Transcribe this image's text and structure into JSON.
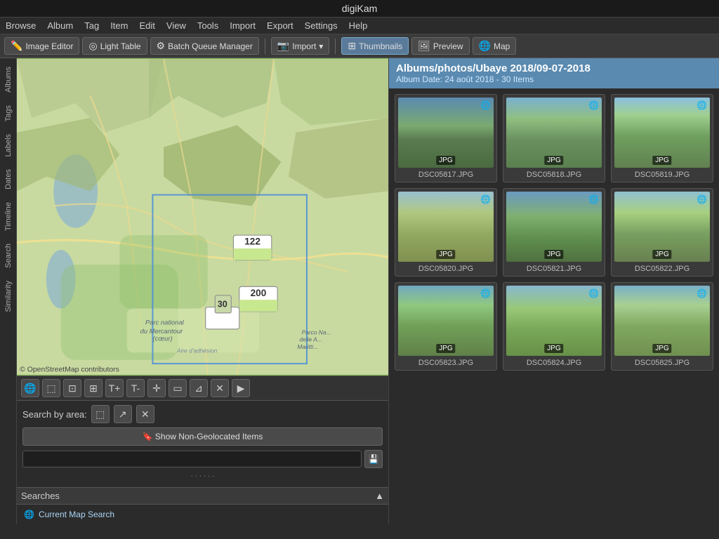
{
  "title_bar": {
    "app_name": "digiKam"
  },
  "menu_bar": {
    "items": [
      "Browse",
      "Album",
      "Tag",
      "Item",
      "Edit",
      "View",
      "Tools",
      "Import",
      "Export",
      "Settings",
      "Help"
    ]
  },
  "toolbar": {
    "buttons": [
      {
        "id": "image-editor",
        "icon": "✏️",
        "label": "Image Editor",
        "active": false
      },
      {
        "id": "light-table",
        "icon": "◎",
        "label": "Light Table",
        "active": false
      },
      {
        "id": "batch-queue",
        "icon": "⚙",
        "label": "Batch Queue Manager",
        "active": false
      },
      {
        "id": "import",
        "icon": "📷",
        "label": "Import",
        "active": false,
        "has_arrow": true
      },
      {
        "id": "thumbnails",
        "icon": "⊞",
        "label": "Thumbnails",
        "active": true
      },
      {
        "id": "preview",
        "icon": "🖼",
        "label": "Preview",
        "active": false
      },
      {
        "id": "map",
        "icon": "🌐",
        "label": "Map",
        "active": false
      }
    ]
  },
  "sidebar": {
    "tabs": [
      "Albums",
      "Tags",
      "Labels",
      "Dates",
      "Timeline",
      "Search",
      "Similarity"
    ]
  },
  "map": {
    "attribution": "© OpenStreetMap contributors",
    "cluster_122": "122",
    "cluster_200": "200",
    "cluster_30": "30"
  },
  "map_toolbar": {
    "buttons": [
      {
        "id": "globe",
        "icon": "🌐"
      },
      {
        "id": "select-area",
        "icon": "⬚"
      },
      {
        "id": "filter-area",
        "icon": "⊡"
      },
      {
        "id": "image-view",
        "icon": "⊞"
      },
      {
        "id": "text",
        "icon": "T+"
      },
      {
        "id": "text-minus",
        "icon": "T-"
      },
      {
        "id": "move",
        "icon": "✛"
      },
      {
        "id": "frame",
        "icon": "▭"
      },
      {
        "id": "filter",
        "icon": "⊿"
      },
      {
        "id": "clear",
        "icon": "✕"
      },
      {
        "id": "play",
        "icon": "▶"
      }
    ]
  },
  "search_area": {
    "label": "Search by area:",
    "area_btns": [
      {
        "id": "area-select",
        "icon": "⬚"
      },
      {
        "id": "area-add",
        "icon": "↗"
      },
      {
        "id": "area-clear",
        "icon": "✕"
      }
    ],
    "show_non_geo_btn": "🔖 Show Non-Geolocated Items",
    "search_placeholder": "",
    "save_icon": "💾",
    "searches_label": "Searches",
    "searches_collapse": "▲",
    "search_items": [
      {
        "id": "current-map-search",
        "icon": "🌐",
        "label": "Current Map Search"
      }
    ]
  },
  "album": {
    "path": "Albums/photos/Ubaye 2018/09-07-2018",
    "date_info": "Album Date: 24 août 2018 - 30 Items"
  },
  "thumbnails": [
    {
      "id": "DSC05817",
      "label": "DSC05817.JPG",
      "badge": "JPG",
      "class": "landscape-1"
    },
    {
      "id": "DSC05818",
      "label": "DSC05818.JPG",
      "badge": "JPG",
      "class": "landscape-2"
    },
    {
      "id": "DSC05819",
      "label": "DSC05819.JPG",
      "badge": "JPG",
      "class": "landscape-3"
    },
    {
      "id": "DSC05820",
      "label": "DSC05820.JPG",
      "badge": "JPG",
      "class": "landscape-9"
    },
    {
      "id": "DSC05821",
      "label": "DSC05821.JPG",
      "badge": "JPG",
      "class": "landscape-4"
    },
    {
      "id": "DSC05822",
      "label": "DSC05822.JPG",
      "badge": "JPG",
      "class": "landscape-5"
    },
    {
      "id": "DSC05823",
      "label": "DSC05823.JPG",
      "badge": "JPG",
      "class": "landscape-6"
    },
    {
      "id": "DSC05824",
      "label": "DSC05824.JPG",
      "badge": "JPG",
      "class": "landscape-7"
    },
    {
      "id": "DSC05825",
      "label": "DSC05825.JPG",
      "badge": "JPG",
      "class": "landscape-8"
    }
  ]
}
